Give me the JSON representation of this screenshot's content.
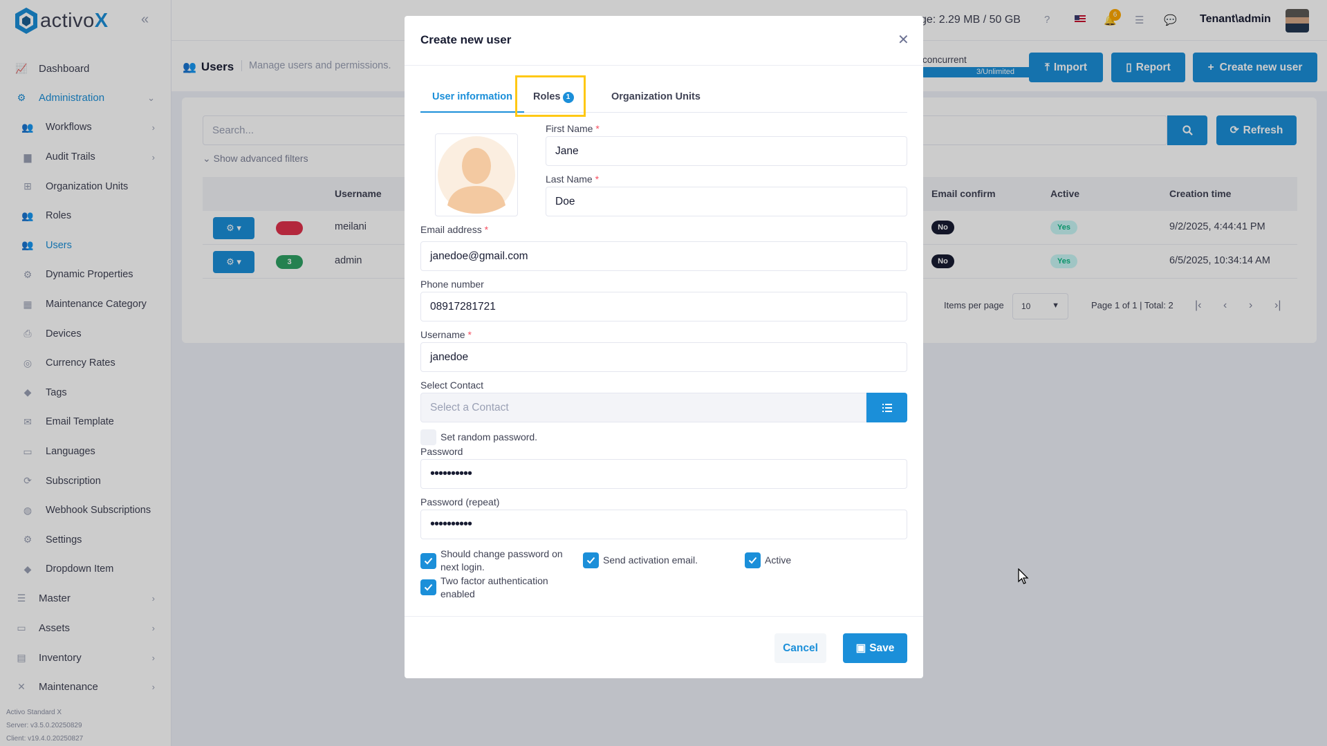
{
  "brand": {
    "name": "activo",
    "name_x": "X"
  },
  "sidebar": {
    "items": [
      {
        "label": "Dashboard",
        "icon": "chart-icon",
        "level": "top"
      },
      {
        "label": "Administration",
        "icon": "cogs-icon",
        "level": "top",
        "active": true,
        "chevron": "down"
      },
      {
        "label": "Workflows",
        "icon": "users-icon",
        "level": "sub",
        "chevron": "right"
      },
      {
        "label": "Audit Trails",
        "icon": "folder-icon",
        "level": "sub",
        "chevron": "right"
      },
      {
        "label": "Organization Units",
        "icon": "sitemap-icon",
        "level": "sub"
      },
      {
        "label": "Roles",
        "icon": "users-icon",
        "level": "sub"
      },
      {
        "label": "Users",
        "icon": "users-icon",
        "level": "sub",
        "active": true
      },
      {
        "label": "Dynamic Properties",
        "icon": "cog-icon",
        "level": "sub"
      },
      {
        "label": "Maintenance Category",
        "icon": "grid-icon",
        "level": "sub"
      },
      {
        "label": "Devices",
        "icon": "printer-icon",
        "level": "sub"
      },
      {
        "label": "Currency Rates",
        "icon": "coins-icon",
        "level": "sub"
      },
      {
        "label": "Tags",
        "icon": "tags-icon",
        "level": "sub"
      },
      {
        "label": "Email Template",
        "icon": "envelope-icon",
        "level": "sub"
      },
      {
        "label": "Languages",
        "icon": "language-icon",
        "level": "sub"
      },
      {
        "label": "Subscription",
        "icon": "sync-icon",
        "level": "sub"
      },
      {
        "label": "Webhook Subscriptions",
        "icon": "globe-icon",
        "level": "sub"
      },
      {
        "label": "Settings",
        "icon": "cog-icon",
        "level": "sub"
      },
      {
        "label": "Dropdown Item",
        "icon": "tags-icon",
        "level": "sub"
      },
      {
        "label": "Master",
        "icon": "database-icon",
        "level": "top",
        "chevron": "right"
      },
      {
        "label": "Assets",
        "icon": "laptop-icon",
        "level": "top",
        "chevron": "right"
      },
      {
        "label": "Inventory",
        "icon": "warehouse-icon",
        "level": "top",
        "chevron": "right"
      },
      {
        "label": "Maintenance",
        "icon": "tools-icon",
        "level": "top",
        "chevron": "right"
      }
    ],
    "version": {
      "product": "Activo Standard X",
      "server": "Server: v3.5.0.20250829",
      "client": "Client: v19.4.0.20250827"
    }
  },
  "topbar": {
    "usage": "ge: 2.29 MB / 50 GB",
    "notification_count": "6",
    "tenant": "Tenant\\admin"
  },
  "header": {
    "title": "Users",
    "description": "Manage users and permissions.",
    "concurrent_label": "concurrent",
    "concurrent_value": "3/Unlimited",
    "import_label": "Import",
    "report_label": "Report",
    "create_label": "Create new user"
  },
  "table": {
    "search_placeholder": "Search...",
    "refresh_label": "Refresh",
    "advanced_filters": "Show advanced filters",
    "columns": {
      "username": "Username",
      "email_confirm": "Email confirm",
      "active": "Active",
      "creation_time": "Creation time"
    },
    "rows": [
      {
        "role_count": "",
        "role_color": "#e0314b",
        "username": "meilani",
        "email_confirm": "No",
        "active": "Yes",
        "creation_time": "9/2/2025, 4:44:41 PM"
      },
      {
        "role_count": "3",
        "role_color": "#2fa265",
        "username": "admin",
        "email_confirm": "No",
        "active": "Yes",
        "creation_time": "6/5/2025, 10:34:14 AM"
      }
    ],
    "items_per_page_label": "Items per page",
    "items_per_page": "10",
    "page_info": "Page 1 of 1 | Total: 2"
  },
  "modal": {
    "title": "Create new user",
    "tabs": [
      {
        "label": "User information",
        "active": true
      },
      {
        "label": "Roles",
        "badge": "1"
      },
      {
        "label": "Organization Units"
      }
    ],
    "fields": {
      "first_name": {
        "label": "First Name",
        "value": "Jane"
      },
      "last_name": {
        "label": "Last Name",
        "value": "Doe"
      },
      "email": {
        "label": "Email address",
        "value": "janedoe@gmail.com"
      },
      "phone": {
        "label": "Phone number",
        "value": "08917281721"
      },
      "username": {
        "label": "Username",
        "value": "janedoe"
      },
      "contact": {
        "label": "Select Contact",
        "placeholder": "Select a Contact"
      },
      "password": {
        "label": "Password",
        "value": "••••••••••"
      },
      "password_repeat": {
        "label": "Password (repeat)",
        "value": "••••••••••"
      }
    },
    "required_mark": "*",
    "checkboxes": {
      "random_password": {
        "label": "Set random password.",
        "checked": false
      },
      "change_password": {
        "label_line1": "Should change password on",
        "label_line2": "next login.",
        "checked": true
      },
      "send_activation": {
        "label": "Send activation email.",
        "checked": true
      },
      "active": {
        "label": "Active",
        "checked": true
      },
      "two_factor": {
        "label_line1": "Two factor authentication",
        "label_line2": "enabled",
        "checked": true
      }
    },
    "cancel_label": "Cancel",
    "save_label": "Save"
  },
  "colors": {
    "accent": "#1b8fd9",
    "highlight": "#ffc814",
    "danger": "#f64e60",
    "success": "#0bb783"
  }
}
